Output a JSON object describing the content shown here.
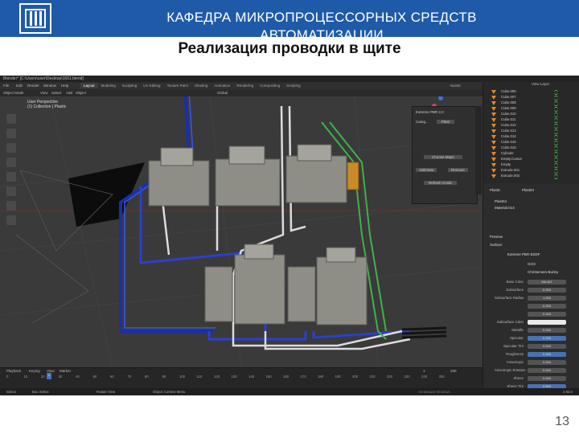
{
  "slide": {
    "header_title": "КАФЕДРА МИКРОПРОЦЕССОРНЫХ СРЕДСТВ АВТОМАТИЗАЦИИ",
    "title": "Реализация проводки в щите",
    "page_number": "13"
  },
  "app": {
    "window_title": "Blender* [C:\\Users\\user\\Desktop\\1651.blend]",
    "menu": [
      "File",
      "Edit",
      "Render",
      "Window",
      "Help"
    ],
    "tabs": [
      "Layout",
      "Modeling",
      "Sculpting",
      "UV Editing",
      "Texture Paint",
      "Shading",
      "Animation",
      "Rendering",
      "Compositing",
      "Scripting"
    ],
    "active_tab": "Layout",
    "scene_label": "Scene",
    "view_layer_label": "View Layer"
  },
  "viewport": {
    "mode": "Object Mode",
    "menus": [
      "View",
      "Select",
      "Add",
      "Object"
    ],
    "orientation": "Global",
    "perspective": "User Perspective",
    "collection": "(1) Collection | Plastic"
  },
  "node_panel": {
    "shader": "Extreme PBR 2.0",
    "category_label": "Categ...",
    "category_value": "Plast",
    "buttons": [
      "Choose Maps",
      "Add New",
      "Remove",
      "Refresh Cmds"
    ]
  },
  "outliner": {
    "items": [
      "Cube.006",
      "Cube.007",
      "Cube.008",
      "Cube.009",
      "Cube.010",
      "Cube.011",
      "Cube.012",
      "Cube.013",
      "Cube.014",
      "Cube.015",
      "Cube.016",
      "Cylinder",
      "Empty.Cutout",
      "Empty",
      "Extrude.001",
      "Extrude.002"
    ]
  },
  "properties": {
    "object": "Plastic",
    "material": "Plast04",
    "slots": [
      "Plast04",
      "Material.014"
    ],
    "sections": [
      "Preview",
      "Surface"
    ],
    "surface": "Extreme PBR BSDF",
    "method": "GGX",
    "subsurface_method": "Christensen-Burley",
    "rows": [
      {
        "label": "Base Color",
        "value": "Mix AO",
        "kind": "plain"
      },
      {
        "label": "Subsurface",
        "value": "0.000",
        "kind": "plain"
      },
      {
        "label": "Subsurface Radius",
        "value": "1.000",
        "kind": "plain"
      },
      {
        "label": "",
        "value": "0.200",
        "kind": "plain"
      },
      {
        "label": "",
        "value": "0.100",
        "kind": "plain"
      },
      {
        "label": "Subsurface Color",
        "value": "",
        "kind": "color"
      },
      {
        "label": "Metallic",
        "value": "0.000",
        "kind": "plain"
      },
      {
        "label": "Specular",
        "value": "0.220",
        "kind": "blue"
      },
      {
        "label": "Specular Tint",
        "value": "0.000",
        "kind": "plain"
      },
      {
        "label": "Roughness",
        "value": "0.400",
        "kind": "blue"
      },
      {
        "label": "Anisotropic",
        "value": "0.000",
        "kind": "plain"
      },
      {
        "label": "Anisotropic Rotation",
        "value": "0.000",
        "kind": "plain"
      },
      {
        "label": "Sheen",
        "value": "0.000",
        "kind": "plain"
      },
      {
        "label": "Sheen Tint",
        "value": "0.500",
        "kind": "blue"
      }
    ]
  },
  "timeline": {
    "menus": [
      "Playback",
      "Keying",
      "View",
      "Marker"
    ],
    "frames": [
      "0",
      "10",
      "20",
      "30",
      "40",
      "50",
      "60",
      "70",
      "80",
      "90",
      "100",
      "110",
      "120",
      "130",
      "140",
      "150",
      "160",
      "170",
      "180",
      "190",
      "200",
      "210",
      "220",
      "230",
      "240",
      "250"
    ],
    "current_frame": "1",
    "start": "1",
    "end": "250"
  },
  "statusbar": {
    "items": [
      "Select",
      "Box Select",
      "Rotate View",
      "Object Context Menu"
    ],
    "version": "2.92.0",
    "activation": "Активация Windows"
  },
  "colors": {
    "header_band": "#1f5aa8",
    "wire_blue": "#2b3fd0",
    "wire_white": "#e6e6e6",
    "wire_green": "#3fb24a",
    "module": "#8e8e86",
    "terminal": "#c98a2a",
    "cable": "#1a1a1a"
  }
}
